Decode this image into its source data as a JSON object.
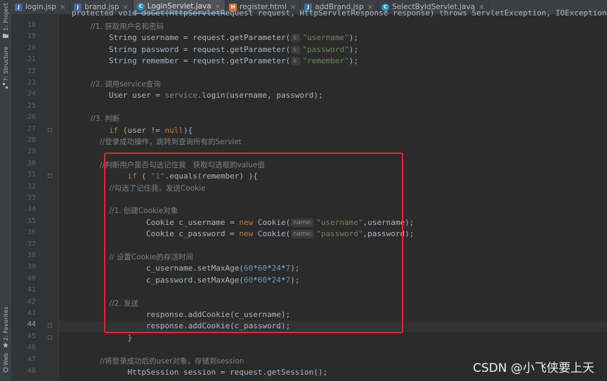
{
  "sidebar": {
    "tabs": [
      {
        "label": "1: Project",
        "icon": "folder-icon"
      },
      {
        "label": "7: Structure",
        "icon": "structure-icon"
      },
      {
        "label": "2: Favorites",
        "icon": "star-icon"
      },
      {
        "label": "Web",
        "icon": "web-icon"
      }
    ]
  },
  "tabs": [
    {
      "label": "login.jsp",
      "type": "jsp",
      "active": false
    },
    {
      "label": "brand.jsp",
      "type": "jsp",
      "active": false
    },
    {
      "label": "LoginServlet.java",
      "type": "java",
      "active": true
    },
    {
      "label": "register.html",
      "type": "html",
      "active": false
    },
    {
      "label": "addBrand.jsp",
      "type": "jsp",
      "active": false
    },
    {
      "label": "SelectByIdServlet.java",
      "type": "java",
      "active": false
    }
  ],
  "editor": {
    "partial_top_line": "protected void doGet(HttpServletRequest request, HttpServletResponse response) throws ServletException, IOException",
    "current_line": 44,
    "lines": [
      {
        "n": 18,
        "tokens": [
          [
            "cm",
            "        //1. 获取用户名和密码"
          ]
        ]
      },
      {
        "n": 19,
        "tokens": [
          [
            "t",
            "        String username = request.getParameter("
          ],
          [
            "hint",
            "s:"
          ],
          [
            "str",
            "\"username\""
          ],
          [
            "t",
            ");"
          ]
        ]
      },
      {
        "n": 20,
        "tokens": [
          [
            "t",
            "        String password = request.getParameter("
          ],
          [
            "hint",
            "s:"
          ],
          [
            "str",
            "\"password\""
          ],
          [
            "t",
            ");"
          ]
        ]
      },
      {
        "n": 21,
        "tokens": [
          [
            "t",
            "        String remember = request.getParameter("
          ],
          [
            "hint",
            "s:"
          ],
          [
            "str",
            "\"remember\""
          ],
          [
            "t",
            ");"
          ]
        ]
      },
      {
        "n": 22,
        "tokens": []
      },
      {
        "n": 23,
        "tokens": [
          [
            "cm",
            "        //2. 调用service查询"
          ]
        ]
      },
      {
        "n": 24,
        "tokens": [
          [
            "t",
            "        User user = "
          ],
          [
            "fld",
            "service"
          ],
          [
            "t",
            ".login(username, password);"
          ]
        ]
      },
      {
        "n": 25,
        "tokens": []
      },
      {
        "n": 26,
        "tokens": [
          [
            "cm",
            "        //3. 判断"
          ]
        ]
      },
      {
        "n": 27,
        "tokens": [
          [
            "kw",
            "        if "
          ],
          [
            "t",
            "(user != "
          ],
          [
            "kw",
            "null"
          ],
          [
            "t",
            "){"
          ]
        ]
      },
      {
        "n": 28,
        "tokens": [
          [
            "cm",
            "            //登录成功操作，跳转到查询所有的Servlet"
          ]
        ]
      },
      {
        "n": 29,
        "tokens": []
      },
      {
        "n": 30,
        "tokens": [
          [
            "cm",
            "            //判断用户是否勾选记住我   获取勾选框的value值"
          ]
        ]
      },
      {
        "n": 31,
        "tokens": [
          [
            "kw",
            "            if "
          ],
          [
            "t",
            "( "
          ],
          [
            "str",
            "\"1\""
          ],
          [
            "t",
            ".equals(remember) ){"
          ]
        ]
      },
      {
        "n": 32,
        "tokens": [
          [
            "cm",
            "                //勾选了记住我，发送Cookie"
          ]
        ]
      },
      {
        "n": 33,
        "tokens": []
      },
      {
        "n": 34,
        "tokens": [
          [
            "cm",
            "                //1. 创建Cookie对象"
          ]
        ]
      },
      {
        "n": 35,
        "tokens": [
          [
            "t",
            "                Cookie c_username = "
          ],
          [
            "kw",
            "new "
          ],
          [
            "t",
            "Cookie("
          ],
          [
            "hint",
            "name:"
          ],
          [
            "str",
            "\"username\""
          ],
          [
            "t",
            ",username);"
          ]
        ]
      },
      {
        "n": 36,
        "tokens": [
          [
            "t",
            "                Cookie c_password = "
          ],
          [
            "kw",
            "new "
          ],
          [
            "t",
            "Cookie("
          ],
          [
            "hint",
            "name:"
          ],
          [
            "str",
            "\"password\""
          ],
          [
            "t",
            ",password);"
          ]
        ]
      },
      {
        "n": 37,
        "tokens": []
      },
      {
        "n": 38,
        "tokens": [
          [
            "cm",
            "                // 设置Cookie的存活时间"
          ]
        ]
      },
      {
        "n": 39,
        "tokens": [
          [
            "t",
            "                c_username.setMaxAge("
          ],
          [
            "num",
            "60"
          ],
          [
            "t",
            "*"
          ],
          [
            "num",
            "60"
          ],
          [
            "t",
            "*"
          ],
          [
            "num",
            "24"
          ],
          [
            "t",
            "*"
          ],
          [
            "num",
            "7"
          ],
          [
            "t",
            ");"
          ]
        ]
      },
      {
        "n": 40,
        "tokens": [
          [
            "t",
            "                c_password.setMaxAge("
          ],
          [
            "num",
            "60"
          ],
          [
            "t",
            "*"
          ],
          [
            "num",
            "60"
          ],
          [
            "t",
            "*"
          ],
          [
            "num",
            "24"
          ],
          [
            "t",
            "*"
          ],
          [
            "num",
            "7"
          ],
          [
            "t",
            ");"
          ]
        ]
      },
      {
        "n": 41,
        "tokens": []
      },
      {
        "n": 42,
        "tokens": [
          [
            "cm",
            "                //2. 发送"
          ]
        ]
      },
      {
        "n": 43,
        "tokens": [
          [
            "t",
            "                response.addCookie(c_username);"
          ]
        ]
      },
      {
        "n": 44,
        "tokens": [
          [
            "t",
            "                response.addCookie(c_password);"
          ]
        ]
      },
      {
        "n": 45,
        "tokens": [
          [
            "t",
            "            }"
          ]
        ]
      },
      {
        "n": 46,
        "tokens": []
      },
      {
        "n": 47,
        "tokens": [
          [
            "cm",
            "            //将登录成功后的user对象，存储到session"
          ]
        ]
      },
      {
        "n": 48,
        "tokens": [
          [
            "t",
            "            HttpSession session = request.getSession();"
          ]
        ]
      }
    ]
  },
  "watermark": "CSDN @小飞侠要上天",
  "colors": {
    "highlight_box": "#e0282a",
    "keyword": "#cc7832",
    "string": "#6a8759",
    "number": "#6897bb",
    "comment": "#808080",
    "field": "#9876aa"
  }
}
